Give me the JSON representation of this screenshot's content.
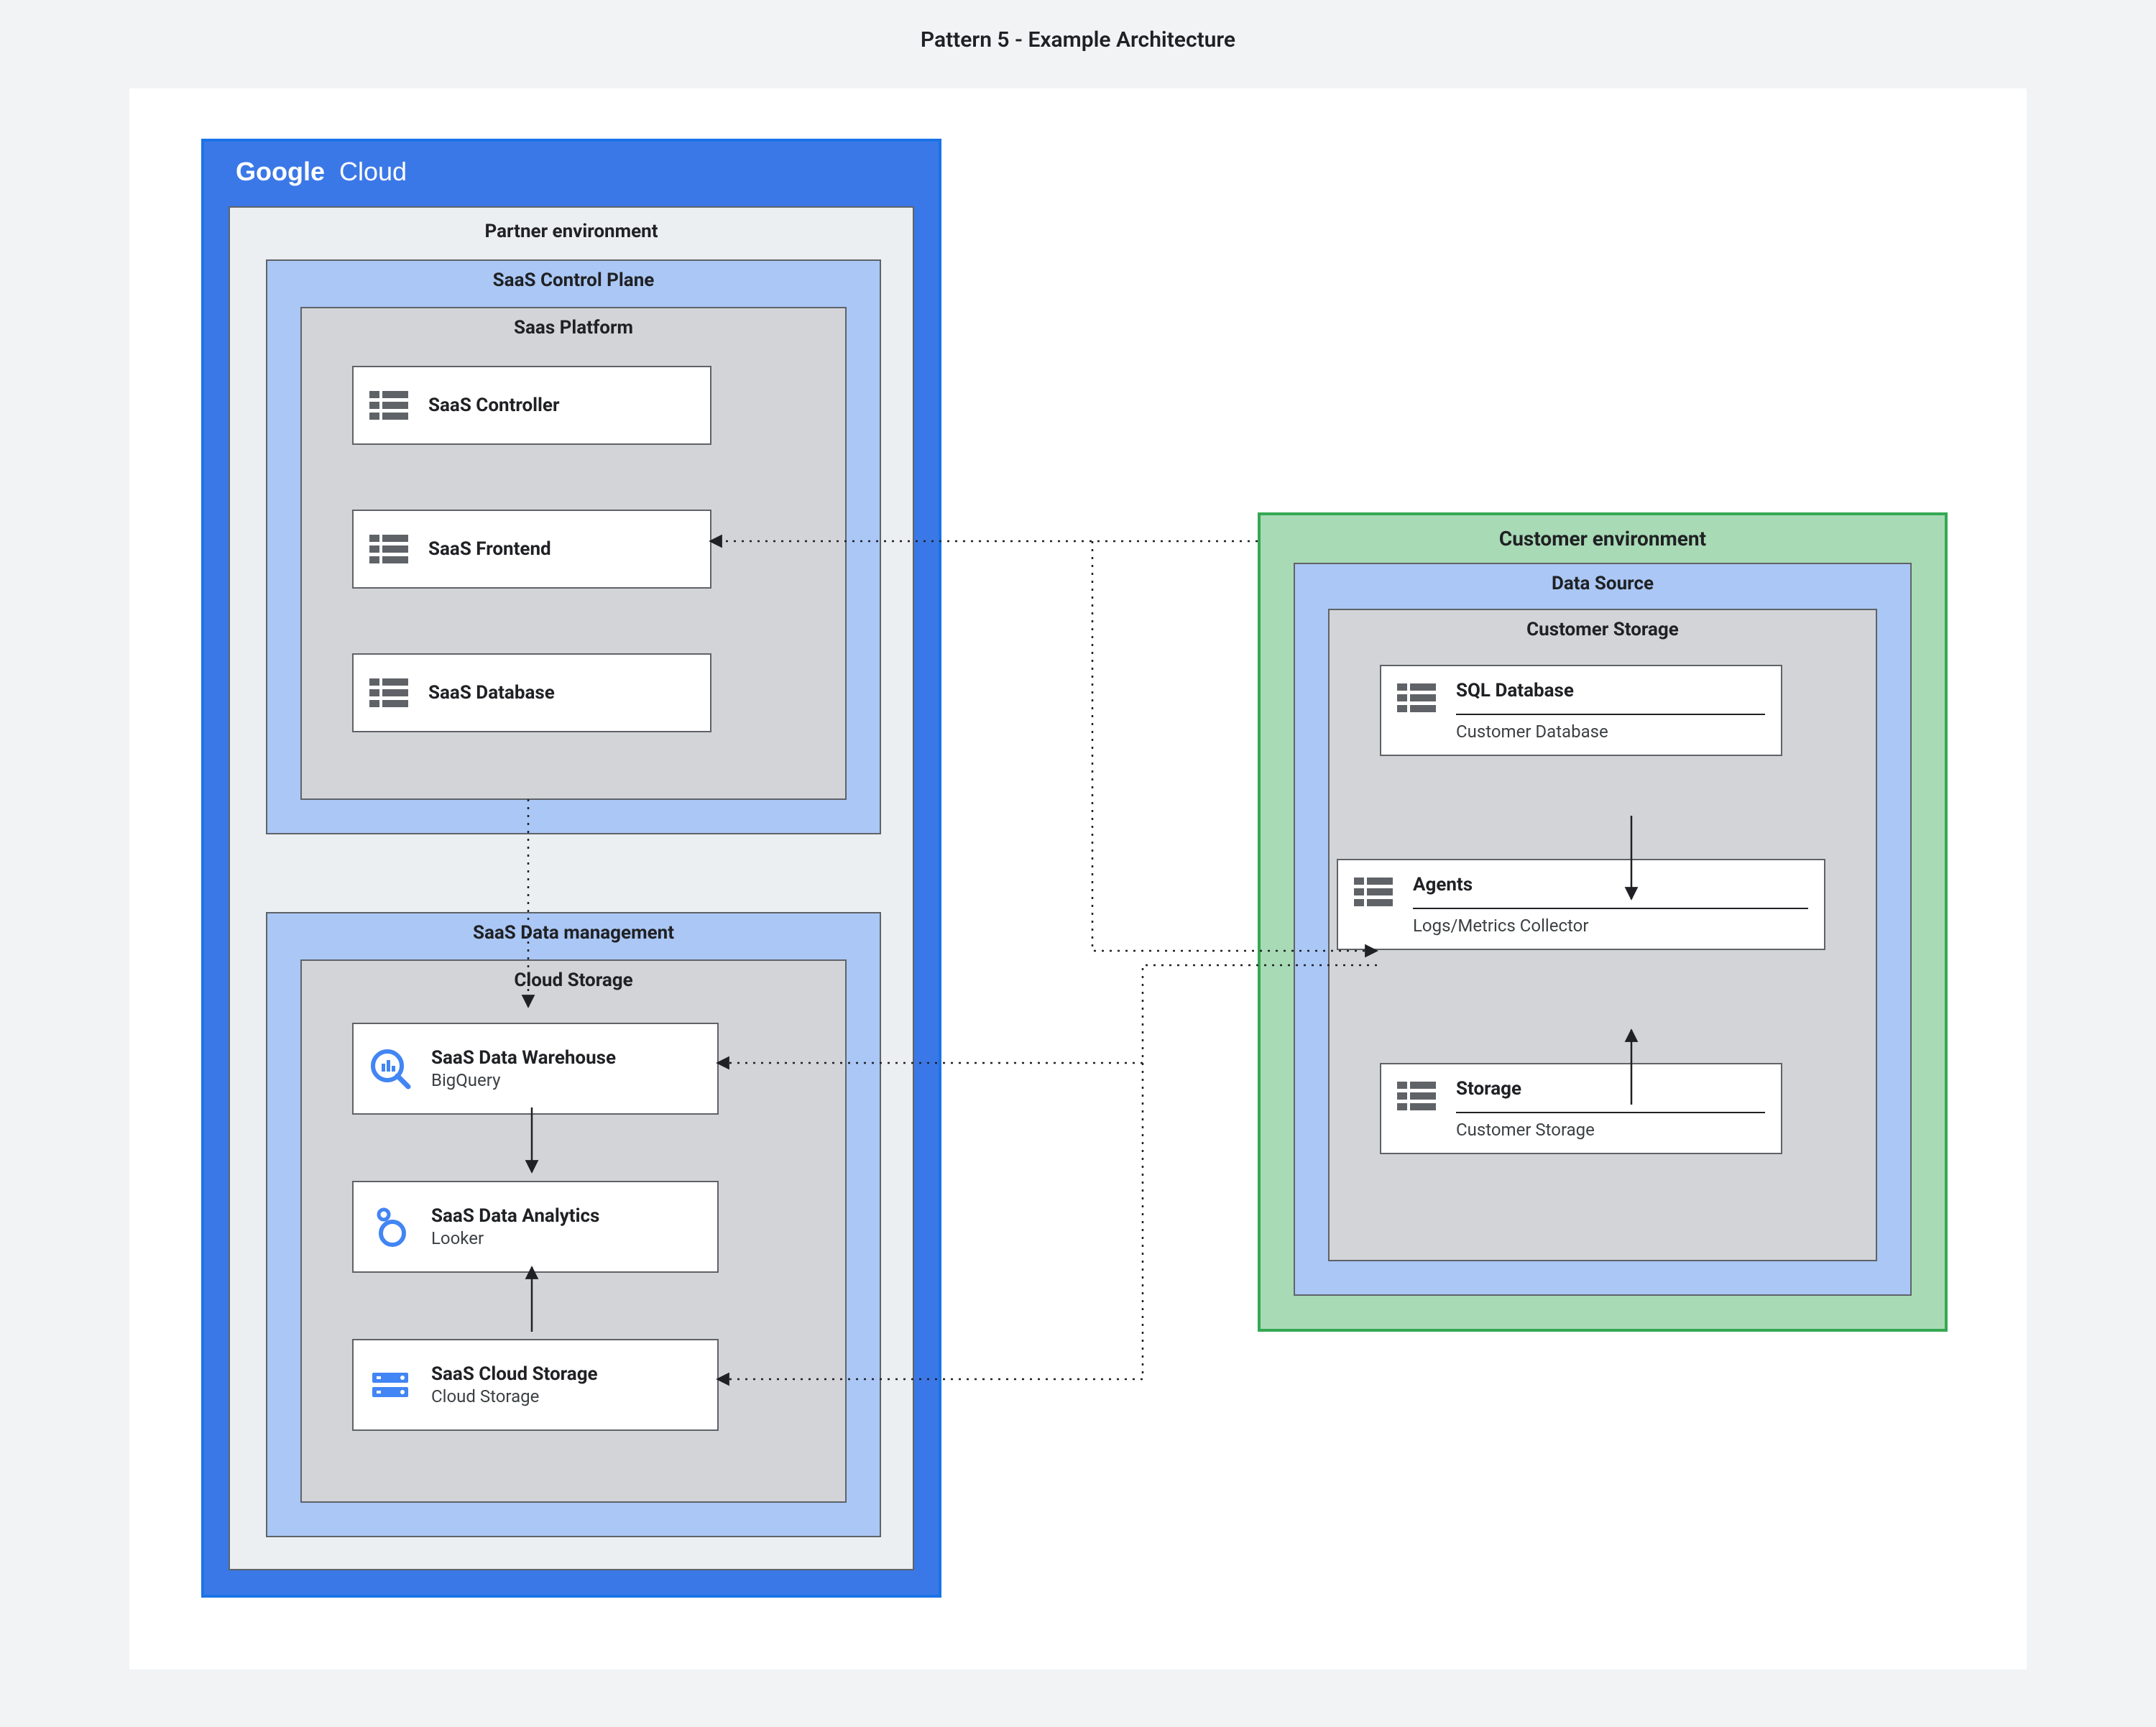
{
  "title": "Pattern 5 - Example Architecture",
  "google_cloud": {
    "brand": "Google",
    "brand2": "Cloud",
    "partner_env_label": "Partner environment",
    "control_plane": {
      "label": "SaaS Control Plane",
      "platform": {
        "label": "Saas Platform",
        "services": [
          {
            "name": "SaaS Controller"
          },
          {
            "name": "SaaS Frontend"
          },
          {
            "name": "SaaS Database"
          }
        ]
      }
    },
    "data_mgmt": {
      "label": "SaaS Data management",
      "cloud_storage": {
        "label": "Cloud Storage",
        "services": [
          {
            "name": "SaaS Data Warehouse",
            "sub": "BigQuery"
          },
          {
            "name": "SaaS Data Analytics",
            "sub": "Looker"
          },
          {
            "name": "SaaS Cloud Storage",
            "sub": "Cloud Storage"
          }
        ]
      }
    }
  },
  "customer": {
    "env_label": "Customer environment",
    "data_source_label": "Data Source",
    "storage_label": "Customer Storage",
    "services": [
      {
        "name": "SQL Database",
        "sub": "Customer Database"
      },
      {
        "name": "Agents",
        "sub": "Logs/Metrics Collector"
      },
      {
        "name": "Storage",
        "sub": "Customer Storage"
      }
    ]
  }
}
